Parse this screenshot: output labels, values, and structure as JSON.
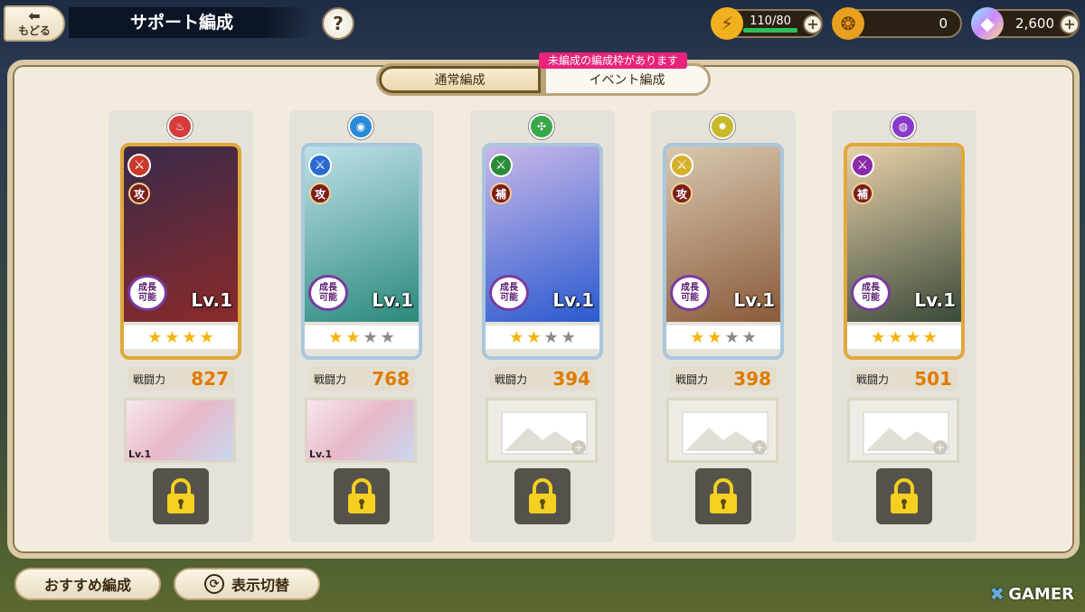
{
  "header": {
    "back_label": "もどる",
    "title": "サポート編成",
    "help": "?"
  },
  "resources": {
    "stamina": "110/80",
    "medal": "0",
    "gem": "2,600"
  },
  "tabs": [
    {
      "label": "通常編成",
      "active": true
    },
    {
      "label": "イベント編成",
      "active": false
    }
  ],
  "notice": "未編成の編成枠があります",
  "colors": {
    "accent_gold": "#e0a83a",
    "notice_pink": "#e8237a",
    "power_orange": "#e07a00"
  },
  "units": [
    {
      "element": "fire",
      "element_color": "#d63a3a",
      "weapon_color": "#c93a2a",
      "role": "攻",
      "level": "Lv.1",
      "growth": [
        "成長",
        "可能"
      ],
      "stars": 4,
      "power_label": "戦闘力",
      "power": "827",
      "frame": "gold",
      "sub_level": "Lv.1",
      "sub_filled": true,
      "portrait": [
        "#3a2a4a",
        "#8a2a2a"
      ]
    },
    {
      "element": "water",
      "element_color": "#2a8ad8",
      "weapon_color": "#2a6ad0",
      "role": "攻",
      "level": "Lv.1",
      "growth": [
        "成長",
        "可能"
      ],
      "stars": 2,
      "power_label": "戦闘力",
      "power": "768",
      "frame": "silver",
      "sub_level": "Lv.1",
      "sub_filled": true,
      "portrait": [
        "#bfe0ea",
        "#2a8a7a"
      ]
    },
    {
      "element": "wind",
      "element_color": "#3aa84a",
      "weapon_color": "#2a8a3a",
      "role": "補",
      "level": "Lv.1",
      "growth": [
        "成長",
        "可能"
      ],
      "stars": 2,
      "power_label": "戦闘力",
      "power": "394",
      "frame": "silver",
      "sub_filled": false,
      "portrait": [
        "#c9b8e8",
        "#2a5ad0"
      ]
    },
    {
      "element": "light",
      "element_color": "#c9b82a",
      "weapon_color": "#d6b02a",
      "role": "攻",
      "level": "Lv.1",
      "growth": [
        "成長",
        "可能"
      ],
      "stars": 2,
      "power_label": "戦闘力",
      "power": "398",
      "frame": "silver",
      "sub_filled": false,
      "portrait": [
        "#d8c8b0",
        "#8a5a3a"
      ]
    },
    {
      "element": "dark",
      "element_color": "#8a3ac8",
      "weapon_color": "#8a2aa8",
      "role": "補",
      "level": "Lv.1",
      "growth": [
        "成長",
        "可能"
      ],
      "stars": 4,
      "power_label": "戦闘力",
      "power": "501",
      "frame": "gold",
      "sub_filled": false,
      "portrait": [
        "#e8d0a8",
        "#3a4a3a"
      ]
    }
  ],
  "bottom": {
    "recommend": "おすすめ編成",
    "toggle": "表示切替"
  },
  "watermark": "GAMER"
}
